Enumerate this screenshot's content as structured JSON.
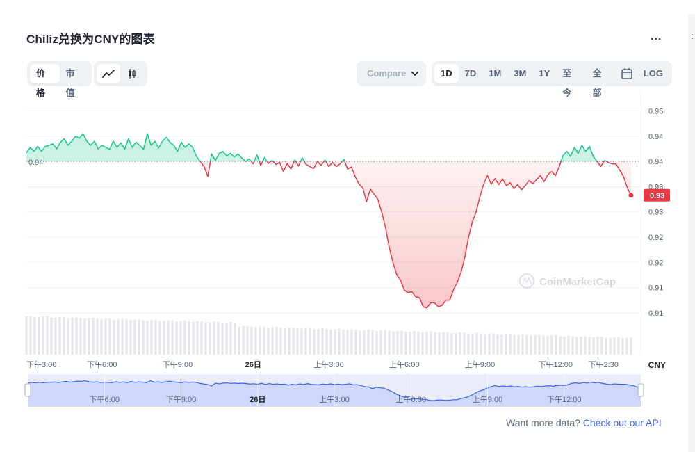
{
  "title": "Chiliz兑换为CNY的图表",
  "more_label": "...",
  "edge_char": ":",
  "view_tabs": [
    {
      "label": "价格",
      "active": true
    },
    {
      "label": "市值",
      "active": false
    }
  ],
  "type_tabs": [
    {
      "icon": "line-chart-icon",
      "active": true
    },
    {
      "icon": "candlestick-icon",
      "active": false
    }
  ],
  "compare": {
    "label": "Compare",
    "icon": "chevron-down-icon"
  },
  "range_tabs": [
    {
      "label": "1D",
      "active": true
    },
    {
      "label": "7D",
      "active": false
    },
    {
      "label": "1M",
      "active": false
    },
    {
      "label": "3M",
      "active": false
    },
    {
      "label": "1Y",
      "active": false
    },
    {
      "label": "至今",
      "active": false
    },
    {
      "label": "全部",
      "active": false
    },
    {
      "icon": "calendar-icon",
      "active": false
    },
    {
      "label": "LOG",
      "active": false
    }
  ],
  "colors": {
    "up": "#16c784",
    "down": "#ea3943",
    "navigator": "#3861fb",
    "text": "#58667e"
  },
  "watermark": "CoinMarketCap",
  "footer": {
    "text": "Want more data?",
    "link": "Check out our API"
  },
  "chart_data": {
    "type": "area",
    "baseline": {
      "value": 0.94,
      "label": "0.94"
    },
    "current": {
      "value": 0.9333,
      "label": "0.93"
    },
    "currency": "CNY",
    "y_ticks": [
      "0.95",
      "0.94",
      "0.94",
      "0.93",
      "0.93",
      "0.92",
      "0.92",
      "0.91",
      "0.91"
    ],
    "y_tick_values": [
      0.95,
      0.945,
      0.94,
      0.935,
      0.93,
      0.925,
      0.92,
      0.915,
      0.91
    ],
    "x_tick_labels": [
      "下午3:00",
      "下午6:00",
      "下午9:00",
      "26日",
      "上午3:00",
      "上午6:00",
      "上午9:00",
      "下午12:00",
      "下午2:30"
    ],
    "x_tick_hours": [
      0,
      3,
      6,
      9,
      12,
      15,
      18,
      21,
      23.5
    ],
    "x_range_hours": [
      0,
      24
    ],
    "navigator_labels": [
      "下午6:00",
      "下午9:00",
      "26日",
      "上午3:00",
      "上午6:00",
      "上午9:00",
      "下午12:00"
    ],
    "navigator_hours": [
      3,
      6,
      9,
      12,
      15,
      18,
      21
    ],
    "price": [
      [
        0.0,
        0.9417
      ],
      [
        0.15,
        0.9428
      ],
      [
        0.3,
        0.942
      ],
      [
        0.45,
        0.943
      ],
      [
        0.6,
        0.942
      ],
      [
        0.75,
        0.943
      ],
      [
        0.9,
        0.9432
      ],
      [
        1.05,
        0.9435
      ],
      [
        1.2,
        0.9425
      ],
      [
        1.35,
        0.9438
      ],
      [
        1.5,
        0.9445
      ],
      [
        1.65,
        0.9432
      ],
      [
        1.8,
        0.944
      ],
      [
        1.95,
        0.945
      ],
      [
        2.1,
        0.9446
      ],
      [
        2.25,
        0.9455
      ],
      [
        2.4,
        0.944
      ],
      [
        2.55,
        0.9432
      ],
      [
        2.7,
        0.944
      ],
      [
        2.85,
        0.9425
      ],
      [
        3.0,
        0.9432
      ],
      [
        3.15,
        0.9428
      ],
      [
        3.3,
        0.9424
      ],
      [
        3.45,
        0.944
      ],
      [
        3.6,
        0.9428
      ],
      [
        3.75,
        0.9437
      ],
      [
        3.9,
        0.9424
      ],
      [
        4.05,
        0.9445
      ],
      [
        4.2,
        0.9428
      ],
      [
        4.35,
        0.9438
      ],
      [
        4.5,
        0.9432
      ],
      [
        4.65,
        0.9424
      ],
      [
        4.8,
        0.9455
      ],
      [
        4.95,
        0.9432
      ],
      [
        5.1,
        0.944
      ],
      [
        5.25,
        0.9427
      ],
      [
        5.4,
        0.944
      ],
      [
        5.55,
        0.9448
      ],
      [
        5.7,
        0.9438
      ],
      [
        5.85,
        0.9432
      ],
      [
        6.0,
        0.942
      ],
      [
        6.15,
        0.9438
      ],
      [
        6.3,
        0.9428
      ],
      [
        6.45,
        0.9435
      ],
      [
        6.6,
        0.9428
      ],
      [
        6.75,
        0.941
      ],
      [
        6.9,
        0.94
      ],
      [
        7.05,
        0.939
      ],
      [
        7.2,
        0.937
      ],
      [
        7.35,
        0.9415
      ],
      [
        7.5,
        0.9402
      ],
      [
        7.65,
        0.9416
      ],
      [
        7.8,
        0.942
      ],
      [
        7.95,
        0.9411
      ],
      [
        8.1,
        0.9416
      ],
      [
        8.25,
        0.9409
      ],
      [
        8.4,
        0.9415
      ],
      [
        8.55,
        0.9407
      ],
      [
        8.7,
        0.94
      ],
      [
        8.85,
        0.9405
      ],
      [
        9.0,
        0.9395
      ],
      [
        9.15,
        0.9413
      ],
      [
        9.3,
        0.9392
      ],
      [
        9.45,
        0.9408
      ],
      [
        9.6,
        0.9396
      ],
      [
        9.75,
        0.9402
      ],
      [
        9.9,
        0.9394
      ],
      [
        10.05,
        0.9398
      ],
      [
        10.2,
        0.938
      ],
      [
        10.35,
        0.9396
      ],
      [
        10.5,
        0.9385
      ],
      [
        10.65,
        0.9403
      ],
      [
        10.8,
        0.9391
      ],
      [
        10.95,
        0.9407
      ],
      [
        11.1,
        0.9394
      ],
      [
        11.25,
        0.939
      ],
      [
        11.4,
        0.9386
      ],
      [
        11.55,
        0.94
      ],
      [
        11.7,
        0.9392
      ],
      [
        11.85,
        0.9403
      ],
      [
        12.0,
        0.939
      ],
      [
        12.15,
        0.9398
      ],
      [
        12.3,
        0.939
      ],
      [
        12.45,
        0.9395
      ],
      [
        12.6,
        0.9404
      ],
      [
        12.75,
        0.9385
      ],
      [
        12.9,
        0.9389
      ],
      [
        13.05,
        0.937
      ],
      [
        13.2,
        0.9355
      ],
      [
        13.35,
        0.9348
      ],
      [
        13.5,
        0.932
      ],
      [
        13.65,
        0.9345
      ],
      [
        13.8,
        0.9335
      ],
      [
        13.95,
        0.9325
      ],
      [
        14.1,
        0.93
      ],
      [
        14.25,
        0.927
      ],
      [
        14.4,
        0.923
      ],
      [
        14.55,
        0.92
      ],
      [
        14.7,
        0.9175
      ],
      [
        14.85,
        0.9165
      ],
      [
        15.0,
        0.9145
      ],
      [
        15.15,
        0.914
      ],
      [
        15.3,
        0.9142
      ],
      [
        15.45,
        0.9132
      ],
      [
        15.6,
        0.913
      ],
      [
        15.75,
        0.9112
      ],
      [
        15.9,
        0.911
      ],
      [
        16.05,
        0.912
      ],
      [
        16.2,
        0.912
      ],
      [
        16.35,
        0.9112
      ],
      [
        16.5,
        0.9115
      ],
      [
        16.65,
        0.9125
      ],
      [
        16.8,
        0.9125
      ],
      [
        16.95,
        0.9145
      ],
      [
        17.1,
        0.916
      ],
      [
        17.25,
        0.918
      ],
      [
        17.4,
        0.921
      ],
      [
        17.55,
        0.925
      ],
      [
        17.7,
        0.928
      ],
      [
        17.85,
        0.93
      ],
      [
        18.0,
        0.933
      ],
      [
        18.15,
        0.9355
      ],
      [
        18.3,
        0.9372
      ],
      [
        18.45,
        0.9355
      ],
      [
        18.6,
        0.9366
      ],
      [
        18.75,
        0.9354
      ],
      [
        18.9,
        0.9365
      ],
      [
        19.05,
        0.9352
      ],
      [
        19.2,
        0.9358
      ],
      [
        19.35,
        0.9346
      ],
      [
        19.5,
        0.9354
      ],
      [
        19.65,
        0.9344
      ],
      [
        19.8,
        0.9352
      ],
      [
        19.95,
        0.9362
      ],
      [
        20.1,
        0.9356
      ],
      [
        20.25,
        0.9364
      ],
      [
        20.4,
        0.9372
      ],
      [
        20.55,
        0.936
      ],
      [
        20.7,
        0.9374
      ],
      [
        20.85,
        0.938
      ],
      [
        21.0,
        0.9372
      ],
      [
        21.15,
        0.939
      ],
      [
        21.3,
        0.9412
      ],
      [
        21.45,
        0.942
      ],
      [
        21.6,
        0.941
      ],
      [
        21.75,
        0.9428
      ],
      [
        21.9,
        0.9416
      ],
      [
        22.05,
        0.9432
      ],
      [
        22.2,
        0.942
      ],
      [
        22.35,
        0.943
      ],
      [
        22.5,
        0.941
      ],
      [
        22.65,
        0.94
      ],
      [
        22.8,
        0.939
      ],
      [
        22.95,
        0.9402
      ],
      [
        23.1,
        0.9398
      ],
      [
        23.25,
        0.9395
      ],
      [
        23.4,
        0.9395
      ],
      [
        23.55,
        0.9383
      ],
      [
        23.7,
        0.937
      ],
      [
        23.85,
        0.9348
      ],
      [
        24.0,
        0.9333
      ]
    ],
    "volume_shape": "declining"
  }
}
